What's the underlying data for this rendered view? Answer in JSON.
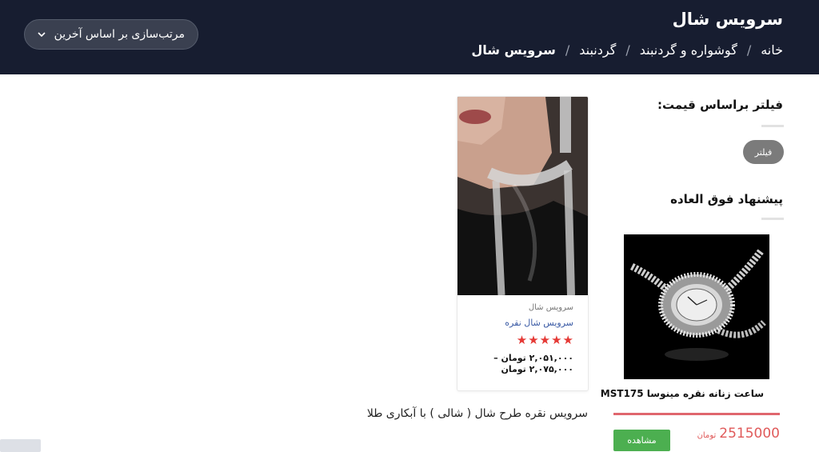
{
  "header": {
    "title": "سرویس شال",
    "breadcrumb": [
      {
        "label": "خانه"
      },
      {
        "label": "گوشواره و گردنبند"
      },
      {
        "label": "گردنبند"
      },
      {
        "label": "سرویس شال"
      }
    ],
    "sort_label": "مرتب‌سازی بر اساس آخرین",
    "sort_icon": "chevron-down-icon"
  },
  "sidebar": {
    "filter_title": "فیلتر براساس قیمت:",
    "filter_button": "فیلتر",
    "special_title": "پیشنهاد فوق العاده",
    "special_product": {
      "name": "ساعت زنانه نقره مینوسا MST175",
      "price": "2515000",
      "currency": "تومان",
      "view_button": "مشاهده"
    }
  },
  "product": {
    "category": "سرویس شال",
    "name": "سرویس شال نقره",
    "rating": 5,
    "price_line1": "۲,۰۵۱,۰۰۰ تومان –",
    "price_line2": "۲,۰۷۵,۰۰۰ تومان",
    "description": "سرویس نقره طرح شال ( شالی ) با آبکاری طلا"
  },
  "colors": {
    "header_bg": "#171d30",
    "accent_red": "#e53935",
    "price_red": "#e05a5a",
    "button_green": "#4caf50"
  }
}
